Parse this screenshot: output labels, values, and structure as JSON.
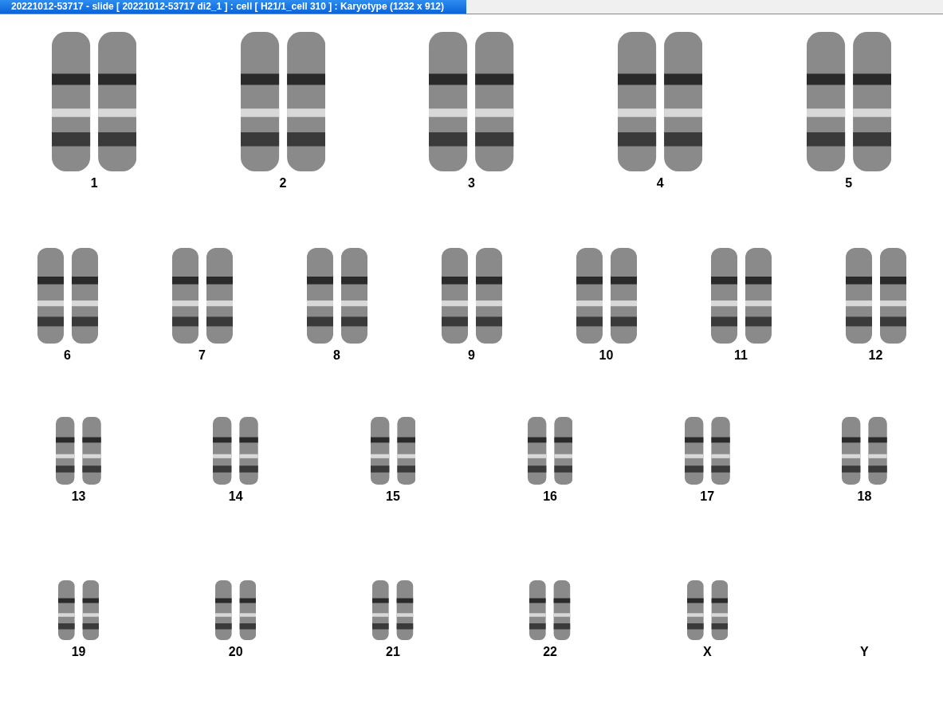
{
  "window": {
    "title": "20221012-53717 - slide [ 20221012-53717 di2_1 ] : cell [ H21/1_cell 310 ] : Karyotype  (1232 x 912)"
  },
  "karyotype": {
    "rows": [
      {
        "items": [
          {
            "label": "1",
            "empty": false
          },
          {
            "label": "2",
            "empty": false
          },
          {
            "label": "3",
            "empty": false
          },
          {
            "label": "4",
            "empty": false
          },
          {
            "label": "5",
            "empty": false
          }
        ]
      },
      {
        "items": [
          {
            "label": "6",
            "empty": false
          },
          {
            "label": "7",
            "empty": false
          },
          {
            "label": "8",
            "empty": false
          },
          {
            "label": "9",
            "empty": false
          },
          {
            "label": "10",
            "empty": false
          },
          {
            "label": "11",
            "empty": false
          },
          {
            "label": "12",
            "empty": false
          }
        ]
      },
      {
        "items": [
          {
            "label": "13",
            "empty": false
          },
          {
            "label": "14",
            "empty": false
          },
          {
            "label": "15",
            "empty": false
          },
          {
            "label": "16",
            "empty": false
          },
          {
            "label": "17",
            "empty": false
          },
          {
            "label": "18",
            "empty": false
          }
        ]
      },
      {
        "items": [
          {
            "label": "19",
            "empty": false
          },
          {
            "label": "20",
            "empty": false
          },
          {
            "label": "21",
            "empty": false
          },
          {
            "label": "22",
            "empty": false
          },
          {
            "label": "X",
            "empty": false
          },
          {
            "label": "Y",
            "empty": true
          }
        ]
      }
    ]
  }
}
